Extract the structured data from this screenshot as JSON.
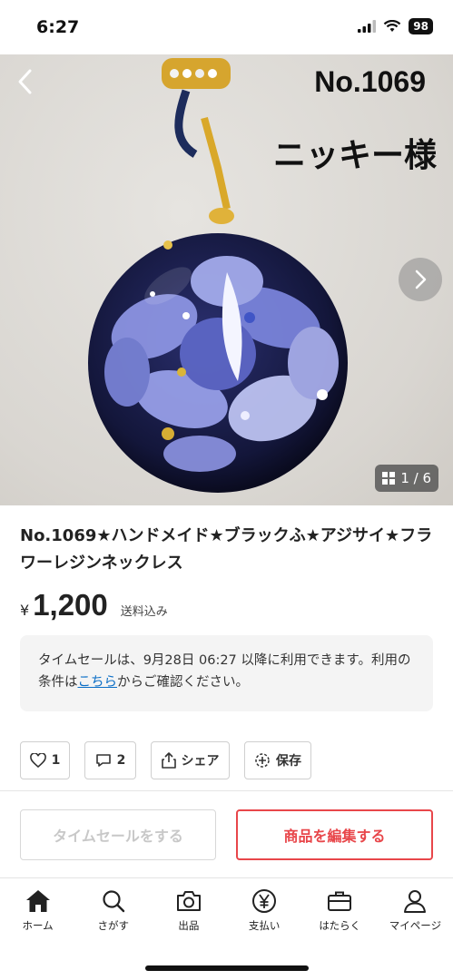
{
  "status": {
    "time": "6:27",
    "battery": "98"
  },
  "hero": {
    "overlay_title": "No.1069",
    "overlay_subtitle": "ニッキー様",
    "counter": "1 / 6"
  },
  "product": {
    "title": "No.1069★ハンドメイド★ブラックふ★アジサイ★フラワーレジンネックレス",
    "currency": "¥",
    "price": "1,200",
    "shipping": "送料込み"
  },
  "notice": {
    "text_before": "タイムセールは、9月28日 06:27 以降に利用できます。利用の条件は",
    "link": "こちら",
    "text_after": "からご確認ください。"
  },
  "actions": {
    "like_count": "1",
    "comment_count": "2",
    "share_label": "シェア",
    "save_label": "保存"
  },
  "cta": {
    "timesale_label": "タイムセールをする",
    "edit_label": "商品を編集する"
  },
  "tabs": [
    {
      "label": "ホーム",
      "icon": "home-icon"
    },
    {
      "label": "さがす",
      "icon": "search-icon"
    },
    {
      "label": "出品",
      "icon": "camera-icon"
    },
    {
      "label": "支払い",
      "icon": "yen-icon"
    },
    {
      "label": "はたらく",
      "icon": "briefcase-icon"
    },
    {
      "label": "マイページ",
      "icon": "person-icon"
    }
  ],
  "colors": {
    "accent": "#e8464a",
    "link": "#0b6ec6"
  }
}
